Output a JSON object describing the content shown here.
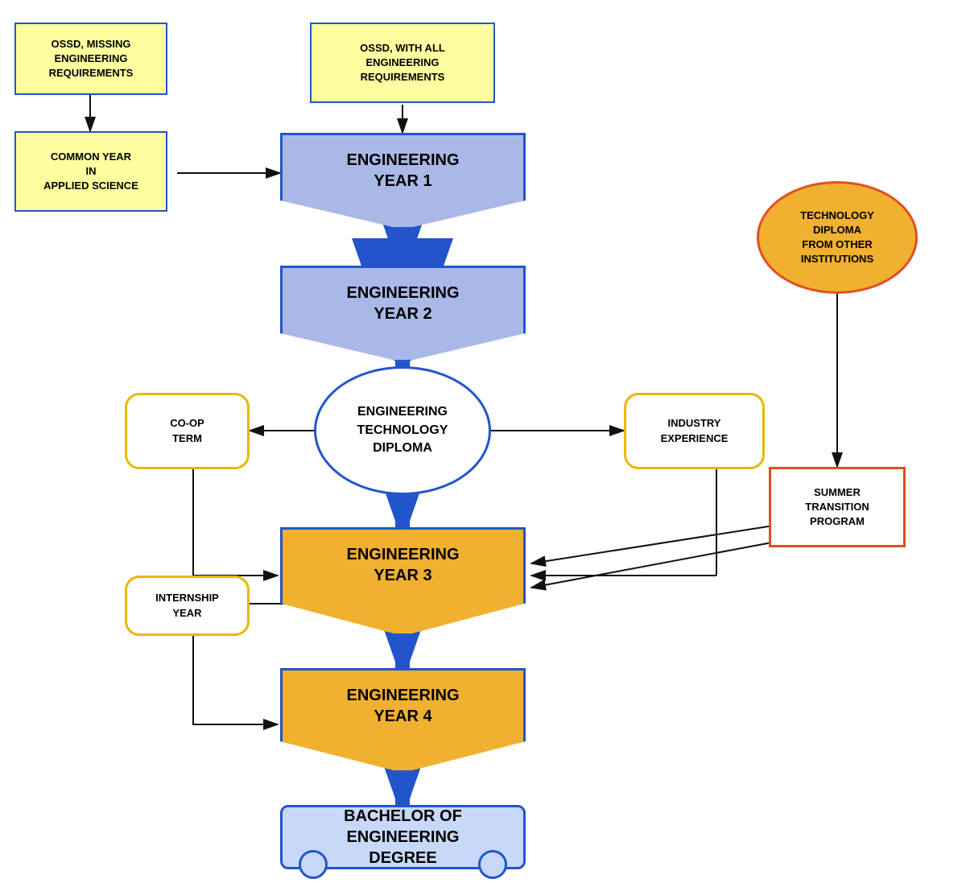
{
  "nodes": {
    "ossd_missing": "OSSD, MISSING\nENGINEERING\nREQUIREMENTS",
    "common_year": "COMMON YEAR\nIN\nAPPLIED SCIENCE",
    "ossd_all": "OSSD, WITH ALL\nENGINEERING\nREQUIREMENTS",
    "eng_year1": "ENGINEERING\nYEAR 1",
    "eng_year2": "ENGINEERING\nYEAR 2",
    "eng_tech_diploma": "ENGINEERING\nTECHNOLOGY\nDIPLOMA",
    "coop_term": "CO-OP\nTERM",
    "industry_exp": "INDUSTRY\nEXPERIENCE",
    "eng_year3": "ENGINEERING\nYEAR 3",
    "internship_year": "INTERNSHIP\nYEAR",
    "eng_year4": "ENGINEERING\nYEAR 4",
    "bachelor": "BACHELOR OF\nENGINEERING\nDEGREE",
    "tech_diploma_other": "TECHNOLOGY\nDIPLOMA\nFROM OTHER\nINSTITUTIONS",
    "summer_transition": "SUMMER\nTRANSITION\nPROGRAM"
  }
}
